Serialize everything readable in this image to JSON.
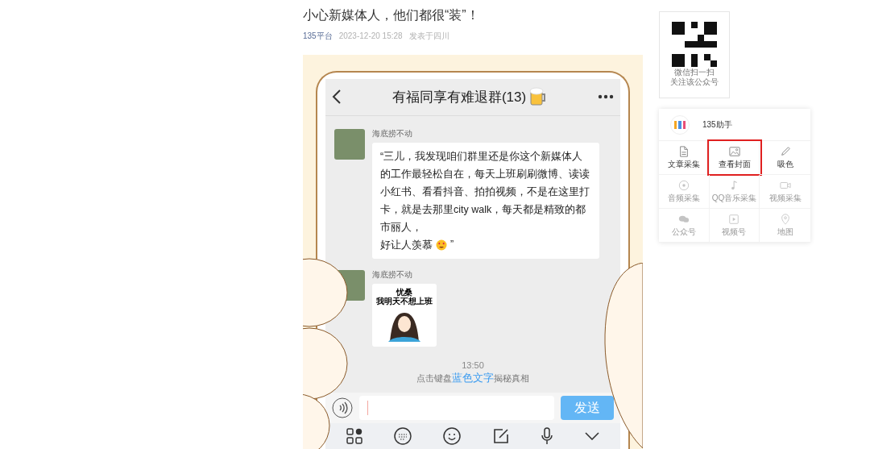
{
  "article": {
    "title": "小心新媒体人，他们都很“装”！",
    "author": "135平台",
    "date": "2023-12-20 15:28",
    "location": "发表于四川"
  },
  "chat": {
    "title": "有福同享有难退群(13)",
    "messages": [
      {
        "kind": "text",
        "sender": "海底捞不动",
        "text": "“三儿，我发现咱们群里还是你这个新媒体人的工作最轻松自在，每天上班刷刷微博、读读小红书、看看抖音、拍拍视频，不是在这里打卡，就是去那里city walk，每天都是精致的都市丽人，",
        "text_end": "好让人羡慕",
        "tail": "”"
      },
      {
        "kind": "sticker",
        "sender": "海底捞不动",
        "caption": [
          "忧桑",
          "我明天不想上班"
        ]
      }
    ],
    "time": "13:50",
    "hint_before": "点击键盘",
    "hint_link": "蓝色文字",
    "hint_after": "揭秘真相",
    "send": "发送"
  },
  "qr": {
    "lines": [
      "微信扫一扫",
      "关注该公众号"
    ]
  },
  "helper": {
    "name": "135助手",
    "tools": [
      {
        "label": "文章采集",
        "kind": "doc",
        "disabled": false,
        "selected": false
      },
      {
        "label": "查看封面",
        "kind": "image",
        "disabled": false,
        "selected": true
      },
      {
        "label": "吸色",
        "kind": "dropper",
        "disabled": false,
        "selected": false
      },
      {
        "label": "音频采集",
        "kind": "disc",
        "disabled": true,
        "selected": false
      },
      {
        "label": "QQ音乐采集",
        "kind": "note",
        "disabled": true,
        "selected": false
      },
      {
        "label": "视频采集",
        "kind": "camera",
        "disabled": true,
        "selected": false
      },
      {
        "label": "公众号",
        "kind": "chat",
        "disabled": true,
        "selected": false
      },
      {
        "label": "视频号",
        "kind": "play",
        "disabled": true,
        "selected": false
      },
      {
        "label": "地图",
        "kind": "pin",
        "disabled": true,
        "selected": false
      }
    ]
  }
}
